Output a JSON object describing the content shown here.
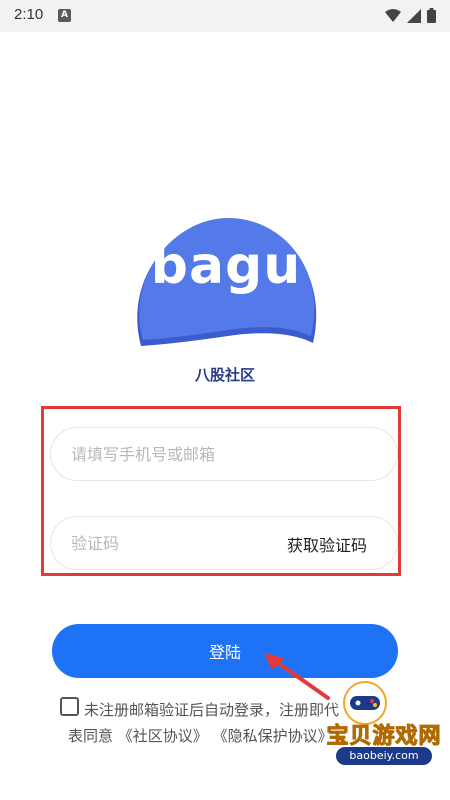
{
  "status_bar": {
    "time": "2:10",
    "notification_letter": "A",
    "icons": [
      "wifi-icon",
      "signal-icon",
      "battery-icon"
    ]
  },
  "logo": {
    "text": "bagu",
    "subtitle": "八股社区",
    "colors": {
      "primary": "#5479e8",
      "shadow": "#3d5bd1"
    }
  },
  "form": {
    "phone_placeholder": "请填写手机号或邮箱",
    "code_placeholder": "验证码",
    "get_code_label": "获取验证码"
  },
  "login_button": {
    "label": "登陆",
    "color": "#1e72f5"
  },
  "agreement": {
    "line1": "未注册邮箱验证后自动登录，注册即代",
    "line2_prefix": "表同意",
    "community_protocol": "《社区协议》",
    "privacy_protocol": "《隐私保护协议》",
    "checked": false
  },
  "watermark": {
    "title": "宝贝游戏网",
    "url": "baobeiy.com"
  },
  "annotation": {
    "highlight_color": "#e4393c"
  }
}
